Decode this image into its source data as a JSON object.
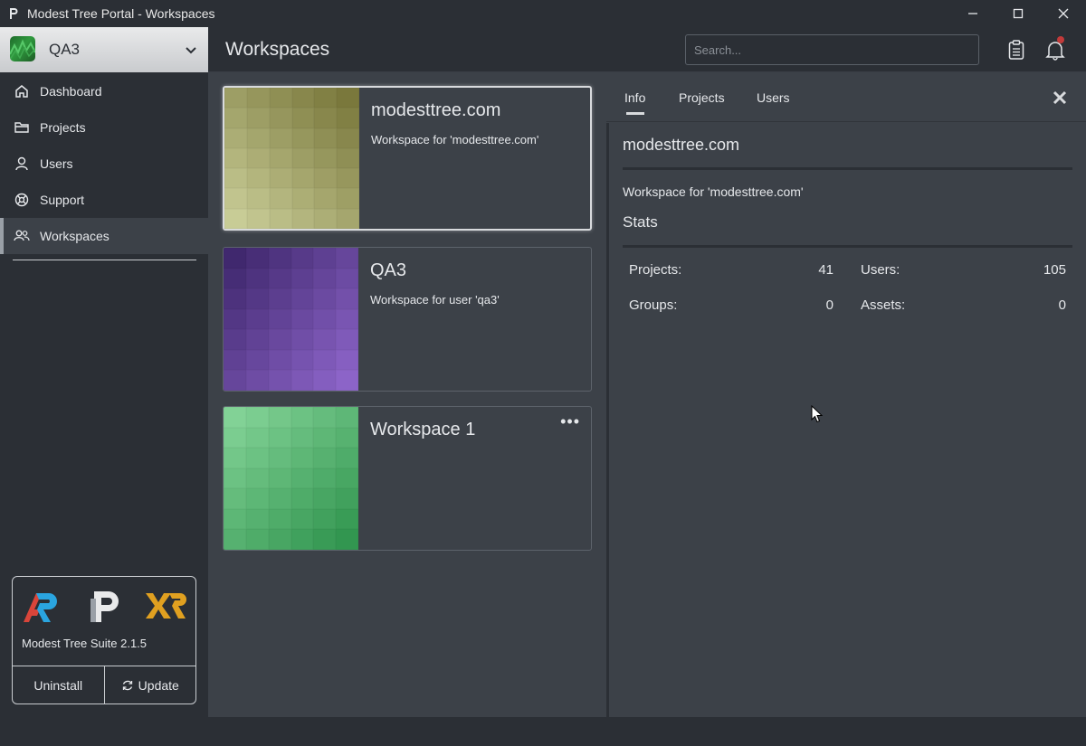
{
  "window": {
    "title": "Modest Tree Portal - Workspaces",
    "icons": [
      "app-logo-icon",
      "minimize-icon",
      "maximize-icon",
      "close-icon"
    ]
  },
  "workspace_selector": {
    "name": "QA3",
    "icon": "chevron-down-icon"
  },
  "nav": {
    "items": [
      {
        "label": "Dashboard",
        "icon": "home-icon"
      },
      {
        "label": "Projects",
        "icon": "folder-icon"
      },
      {
        "label": "Users",
        "icon": "user-icon"
      },
      {
        "label": "Support",
        "icon": "lifebuoy-icon"
      },
      {
        "label": "Workspaces",
        "icon": "users-group-icon",
        "active": true
      }
    ]
  },
  "suite": {
    "label": "Modest Tree Suite 2.1.5",
    "uninstall_label": "Uninstall",
    "update_label": "Update",
    "logos": [
      "ar-logo",
      "p-logo",
      "xr-logo"
    ]
  },
  "header": {
    "title": "Workspaces",
    "search_placeholder": "Search...",
    "icons": [
      "clipboard-icon",
      "bell-icon"
    ]
  },
  "workspaces": [
    {
      "title": "modesttree.com",
      "description": "Workspace for 'modesttree.com'",
      "selected": true,
      "palette": "olive"
    },
    {
      "title": "QA3",
      "description": "Workspace for user 'qa3'",
      "palette": "purple"
    },
    {
      "title": "Workspace 1",
      "description": "",
      "palette": "green",
      "menu": "•••"
    }
  ],
  "panel": {
    "tabs": [
      {
        "label": "Info",
        "active": true
      },
      {
        "label": "Projects"
      },
      {
        "label": "Users"
      }
    ],
    "title": "modesttree.com",
    "description": "Workspace for 'modesttree.com'",
    "stats_heading": "Stats",
    "stats": {
      "projects_label": "Projects:",
      "projects_value": "41",
      "users_label": "Users:",
      "users_value": "105",
      "groups_label": "Groups:",
      "groups_value": "0",
      "assets_label": "Assets:",
      "assets_value": "0"
    }
  },
  "colors": {
    "background": "#2b2f35",
    "panel": "#3c4148",
    "text": "#e6e8eb",
    "notification_dot": "#c23a3a"
  }
}
